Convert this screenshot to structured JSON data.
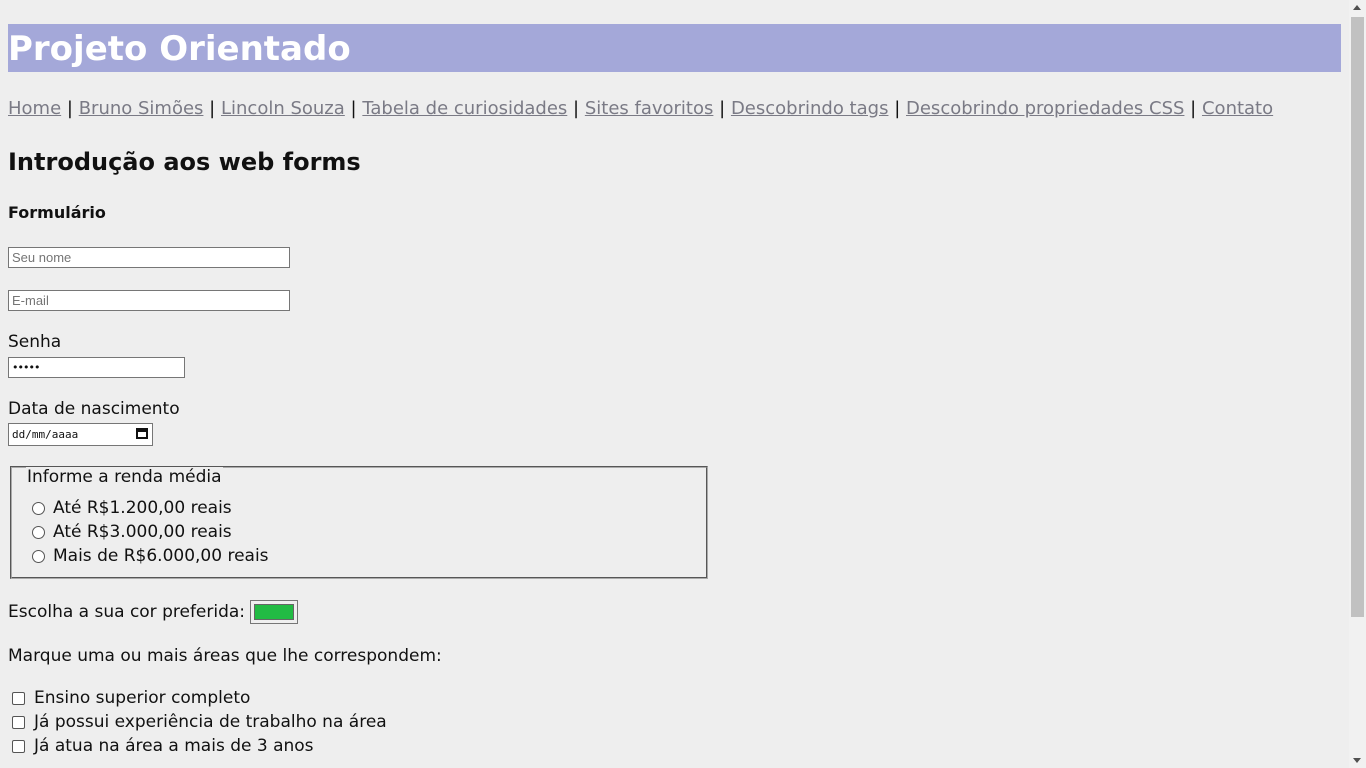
{
  "header": {
    "title": "Projeto Orientado"
  },
  "nav": {
    "items": [
      {
        "label": "Home"
      },
      {
        "label": "Bruno Simões"
      },
      {
        "label": "Lincoln Souza"
      },
      {
        "label": "Tabela de curiosidades"
      },
      {
        "label": "Sites favoritos"
      },
      {
        "label": "Descobrindo tags"
      },
      {
        "label": "Descobrindo propriedades CSS"
      },
      {
        "label": "Contato"
      }
    ],
    "separator": "|"
  },
  "main": {
    "heading": "Introdução aos web forms",
    "form_title": "Formulário",
    "name_placeholder": "Seu nome",
    "email_placeholder": "E-mail",
    "password_label": "Senha",
    "password_value": "•••••",
    "birth_label": "Data de nascimento",
    "birth_placeholder": "dd/mm/aaaa",
    "income": {
      "legend": "Informe a renda média",
      "options": [
        "Até R$1.200,00 reais",
        "Até R$3.000,00 reais",
        "Mais de R$6.000,00 reais"
      ]
    },
    "color_label": "Escolha a sua cor preferida:",
    "color_value": "#22bb44",
    "areas_label": "Marque uma ou mais áreas que lhe correspondem:",
    "areas": [
      "Ensino superior completo",
      "Já possui experiência de trabalho na área",
      "Já atua na área a mais de 3 anos"
    ]
  },
  "colors": {
    "header_bg": "#a4a8d9",
    "link": "#7a7a85",
    "page_bg": "#eeeeee"
  }
}
